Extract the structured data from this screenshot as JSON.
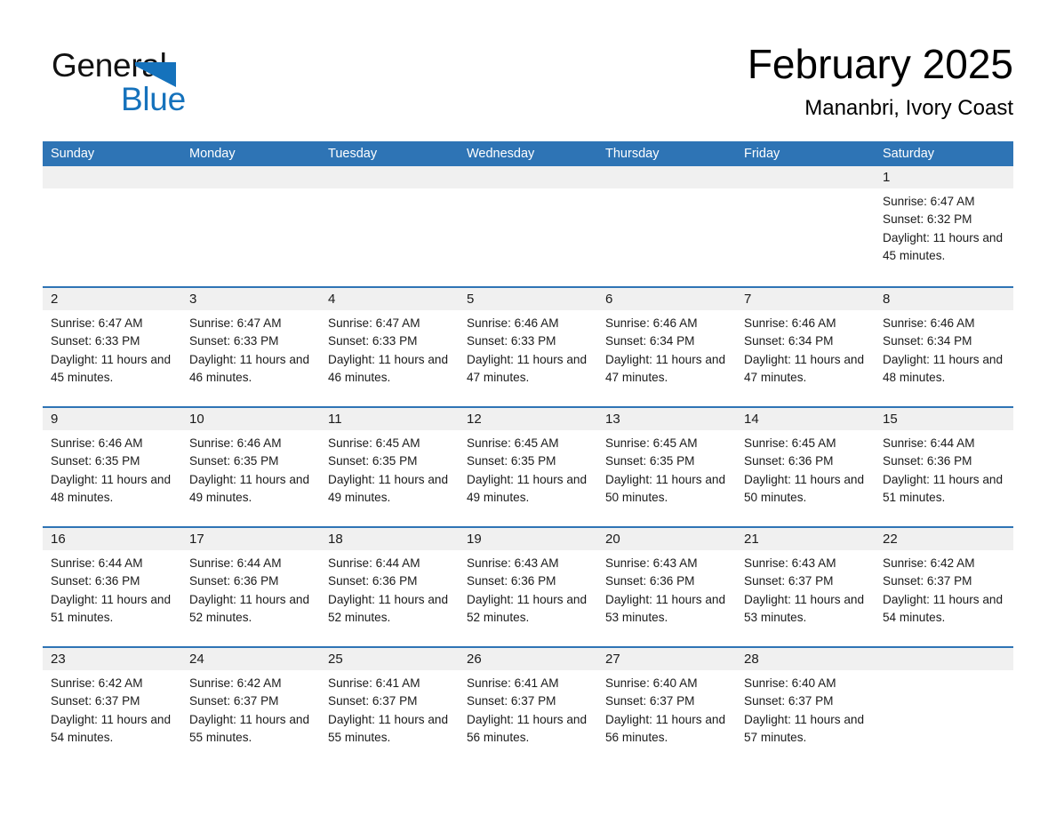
{
  "brand": {
    "name_part1": "General",
    "name_part2": "Blue",
    "triangle_icon": "blue-triangle-icon",
    "accent_color": "#1572BC"
  },
  "header": {
    "month_title": "February 2025",
    "location": "Mananbri, Ivory Coast"
  },
  "calendar": {
    "header_color": "#2E74B5",
    "day_band_color": "#F0F0F0",
    "weekdays": [
      "Sunday",
      "Monday",
      "Tuesday",
      "Wednesday",
      "Thursday",
      "Friday",
      "Saturday"
    ],
    "weeks": [
      [
        {
          "day": "",
          "sunrise": "",
          "sunset": "",
          "daylight": ""
        },
        {
          "day": "",
          "sunrise": "",
          "sunset": "",
          "daylight": ""
        },
        {
          "day": "",
          "sunrise": "",
          "sunset": "",
          "daylight": ""
        },
        {
          "day": "",
          "sunrise": "",
          "sunset": "",
          "daylight": ""
        },
        {
          "day": "",
          "sunrise": "",
          "sunset": "",
          "daylight": ""
        },
        {
          "day": "",
          "sunrise": "",
          "sunset": "",
          "daylight": ""
        },
        {
          "day": "1",
          "sunrise": "Sunrise: 6:47 AM",
          "sunset": "Sunset: 6:32 PM",
          "daylight": "Daylight: 11 hours and 45 minutes."
        }
      ],
      [
        {
          "day": "2",
          "sunrise": "Sunrise: 6:47 AM",
          "sunset": "Sunset: 6:33 PM",
          "daylight": "Daylight: 11 hours and 45 minutes."
        },
        {
          "day": "3",
          "sunrise": "Sunrise: 6:47 AM",
          "sunset": "Sunset: 6:33 PM",
          "daylight": "Daylight: 11 hours and 46 minutes."
        },
        {
          "day": "4",
          "sunrise": "Sunrise: 6:47 AM",
          "sunset": "Sunset: 6:33 PM",
          "daylight": "Daylight: 11 hours and 46 minutes."
        },
        {
          "day": "5",
          "sunrise": "Sunrise: 6:46 AM",
          "sunset": "Sunset: 6:33 PM",
          "daylight": "Daylight: 11 hours and 47 minutes."
        },
        {
          "day": "6",
          "sunrise": "Sunrise: 6:46 AM",
          "sunset": "Sunset: 6:34 PM",
          "daylight": "Daylight: 11 hours and 47 minutes."
        },
        {
          "day": "7",
          "sunrise": "Sunrise: 6:46 AM",
          "sunset": "Sunset: 6:34 PM",
          "daylight": "Daylight: 11 hours and 47 minutes."
        },
        {
          "day": "8",
          "sunrise": "Sunrise: 6:46 AM",
          "sunset": "Sunset: 6:34 PM",
          "daylight": "Daylight: 11 hours and 48 minutes."
        }
      ],
      [
        {
          "day": "9",
          "sunrise": "Sunrise: 6:46 AM",
          "sunset": "Sunset: 6:35 PM",
          "daylight": "Daylight: 11 hours and 48 minutes."
        },
        {
          "day": "10",
          "sunrise": "Sunrise: 6:46 AM",
          "sunset": "Sunset: 6:35 PM",
          "daylight": "Daylight: 11 hours and 49 minutes."
        },
        {
          "day": "11",
          "sunrise": "Sunrise: 6:45 AM",
          "sunset": "Sunset: 6:35 PM",
          "daylight": "Daylight: 11 hours and 49 minutes."
        },
        {
          "day": "12",
          "sunrise": "Sunrise: 6:45 AM",
          "sunset": "Sunset: 6:35 PM",
          "daylight": "Daylight: 11 hours and 49 minutes."
        },
        {
          "day": "13",
          "sunrise": "Sunrise: 6:45 AM",
          "sunset": "Sunset: 6:35 PM",
          "daylight": "Daylight: 11 hours and 50 minutes."
        },
        {
          "day": "14",
          "sunrise": "Sunrise: 6:45 AM",
          "sunset": "Sunset: 6:36 PM",
          "daylight": "Daylight: 11 hours and 50 minutes."
        },
        {
          "day": "15",
          "sunrise": "Sunrise: 6:44 AM",
          "sunset": "Sunset: 6:36 PM",
          "daylight": "Daylight: 11 hours and 51 minutes."
        }
      ],
      [
        {
          "day": "16",
          "sunrise": "Sunrise: 6:44 AM",
          "sunset": "Sunset: 6:36 PM",
          "daylight": "Daylight: 11 hours and 51 minutes."
        },
        {
          "day": "17",
          "sunrise": "Sunrise: 6:44 AM",
          "sunset": "Sunset: 6:36 PM",
          "daylight": "Daylight: 11 hours and 52 minutes."
        },
        {
          "day": "18",
          "sunrise": "Sunrise: 6:44 AM",
          "sunset": "Sunset: 6:36 PM",
          "daylight": "Daylight: 11 hours and 52 minutes."
        },
        {
          "day": "19",
          "sunrise": "Sunrise: 6:43 AM",
          "sunset": "Sunset: 6:36 PM",
          "daylight": "Daylight: 11 hours and 52 minutes."
        },
        {
          "day": "20",
          "sunrise": "Sunrise: 6:43 AM",
          "sunset": "Sunset: 6:36 PM",
          "daylight": "Daylight: 11 hours and 53 minutes."
        },
        {
          "day": "21",
          "sunrise": "Sunrise: 6:43 AM",
          "sunset": "Sunset: 6:37 PM",
          "daylight": "Daylight: 11 hours and 53 minutes."
        },
        {
          "day": "22",
          "sunrise": "Sunrise: 6:42 AM",
          "sunset": "Sunset: 6:37 PM",
          "daylight": "Daylight: 11 hours and 54 minutes."
        }
      ],
      [
        {
          "day": "23",
          "sunrise": "Sunrise: 6:42 AM",
          "sunset": "Sunset: 6:37 PM",
          "daylight": "Daylight: 11 hours and 54 minutes."
        },
        {
          "day": "24",
          "sunrise": "Sunrise: 6:42 AM",
          "sunset": "Sunset: 6:37 PM",
          "daylight": "Daylight: 11 hours and 55 minutes."
        },
        {
          "day": "25",
          "sunrise": "Sunrise: 6:41 AM",
          "sunset": "Sunset: 6:37 PM",
          "daylight": "Daylight: 11 hours and 55 minutes."
        },
        {
          "day": "26",
          "sunrise": "Sunrise: 6:41 AM",
          "sunset": "Sunset: 6:37 PM",
          "daylight": "Daylight: 11 hours and 56 minutes."
        },
        {
          "day": "27",
          "sunrise": "Sunrise: 6:40 AM",
          "sunset": "Sunset: 6:37 PM",
          "daylight": "Daylight: 11 hours and 56 minutes."
        },
        {
          "day": "28",
          "sunrise": "Sunrise: 6:40 AM",
          "sunset": "Sunset: 6:37 PM",
          "daylight": "Daylight: 11 hours and 57 minutes."
        },
        {
          "day": "",
          "sunrise": "",
          "sunset": "",
          "daylight": ""
        }
      ]
    ]
  }
}
